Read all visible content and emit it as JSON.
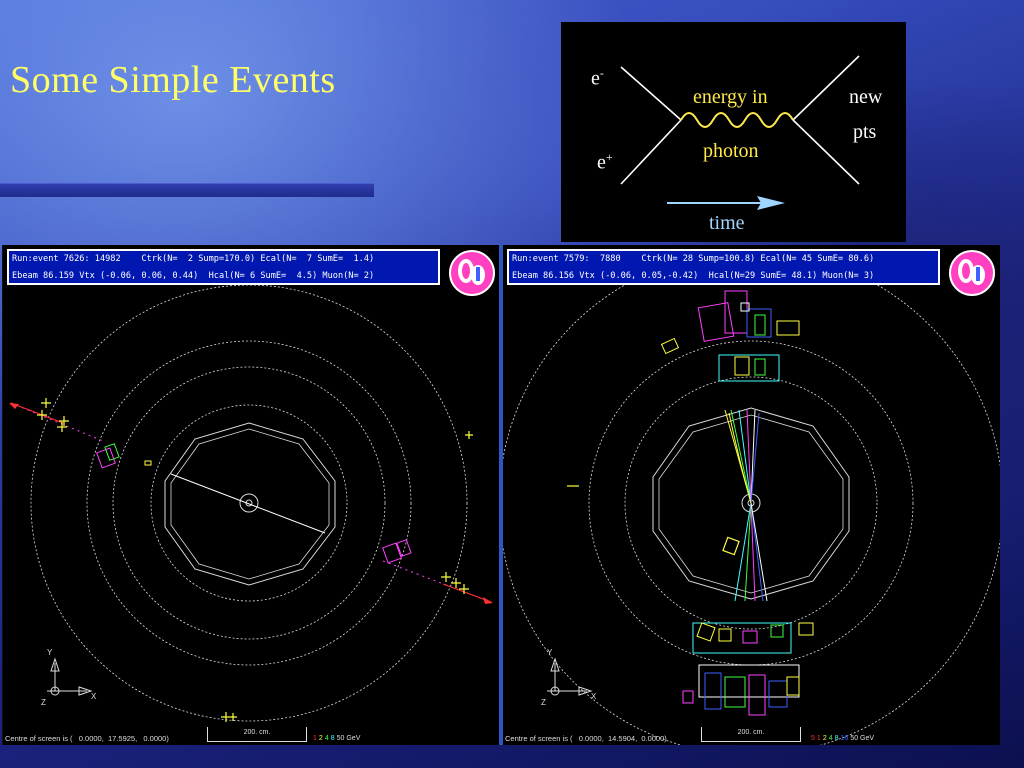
{
  "slide": {
    "title": "Some Simple Events"
  },
  "feynman": {
    "electron_label": "e",
    "electron_sup": "-",
    "positron_label": "e",
    "positron_sup": "+",
    "energy_label": "energy in",
    "photon_label": "photon",
    "new_label": "new",
    "pts_label": "pts",
    "time_label": "time",
    "colors": {
      "lines": "#ffffff",
      "photon": "#ffe94a",
      "time_arrow": "#9fd6ff"
    }
  },
  "events": [
    {
      "info_line1": "Run:event 7626: 14982    Ctrk(N=  2 Sump=170.0) Ecal(N=  7 SumE=  1.4)",
      "info_line2": "Ebeam 86.159 Vtx (-0.06, 0.06, 0.44)  Hcal(N= 6 SumE=  4.5) Muon(N= 2)",
      "centre_text": "Centre of screen is (   0.0000,  17.5925,   0.0000)",
      "scale_label": "200. cm.",
      "energy_legend": [
        "1",
        "2",
        "4",
        "8",
        "50 GeV"
      ]
    },
    {
      "info_line1": "Run:event 7579:  7880    Ctrk(N= 28 Sump=100.8) Ecal(N= 45 SumE= 80.6)",
      "info_line2": "Ebeam 86.156 Vtx (-0.06, 0.05,-0.42)  Hcal(N=29 SumE= 48.1) Muon(N= 3)",
      "centre_text": "Centre of screen is (   0.0000,  14.5904,  0.0000)",
      "scale_label": "200. cm.",
      "energy_legend": [
        "5",
        "1",
        "2",
        "4",
        "8",
        "16",
        "50 GeV"
      ]
    }
  ],
  "axis_labels": {
    "y": "Y",
    "z": "Z",
    "x": "X"
  },
  "legend_colors": [
    "#ff3030",
    "#ffff40",
    "#40ff40",
    "#40ffff",
    "#4060ff",
    "#ff40ff",
    "#ffffff"
  ]
}
